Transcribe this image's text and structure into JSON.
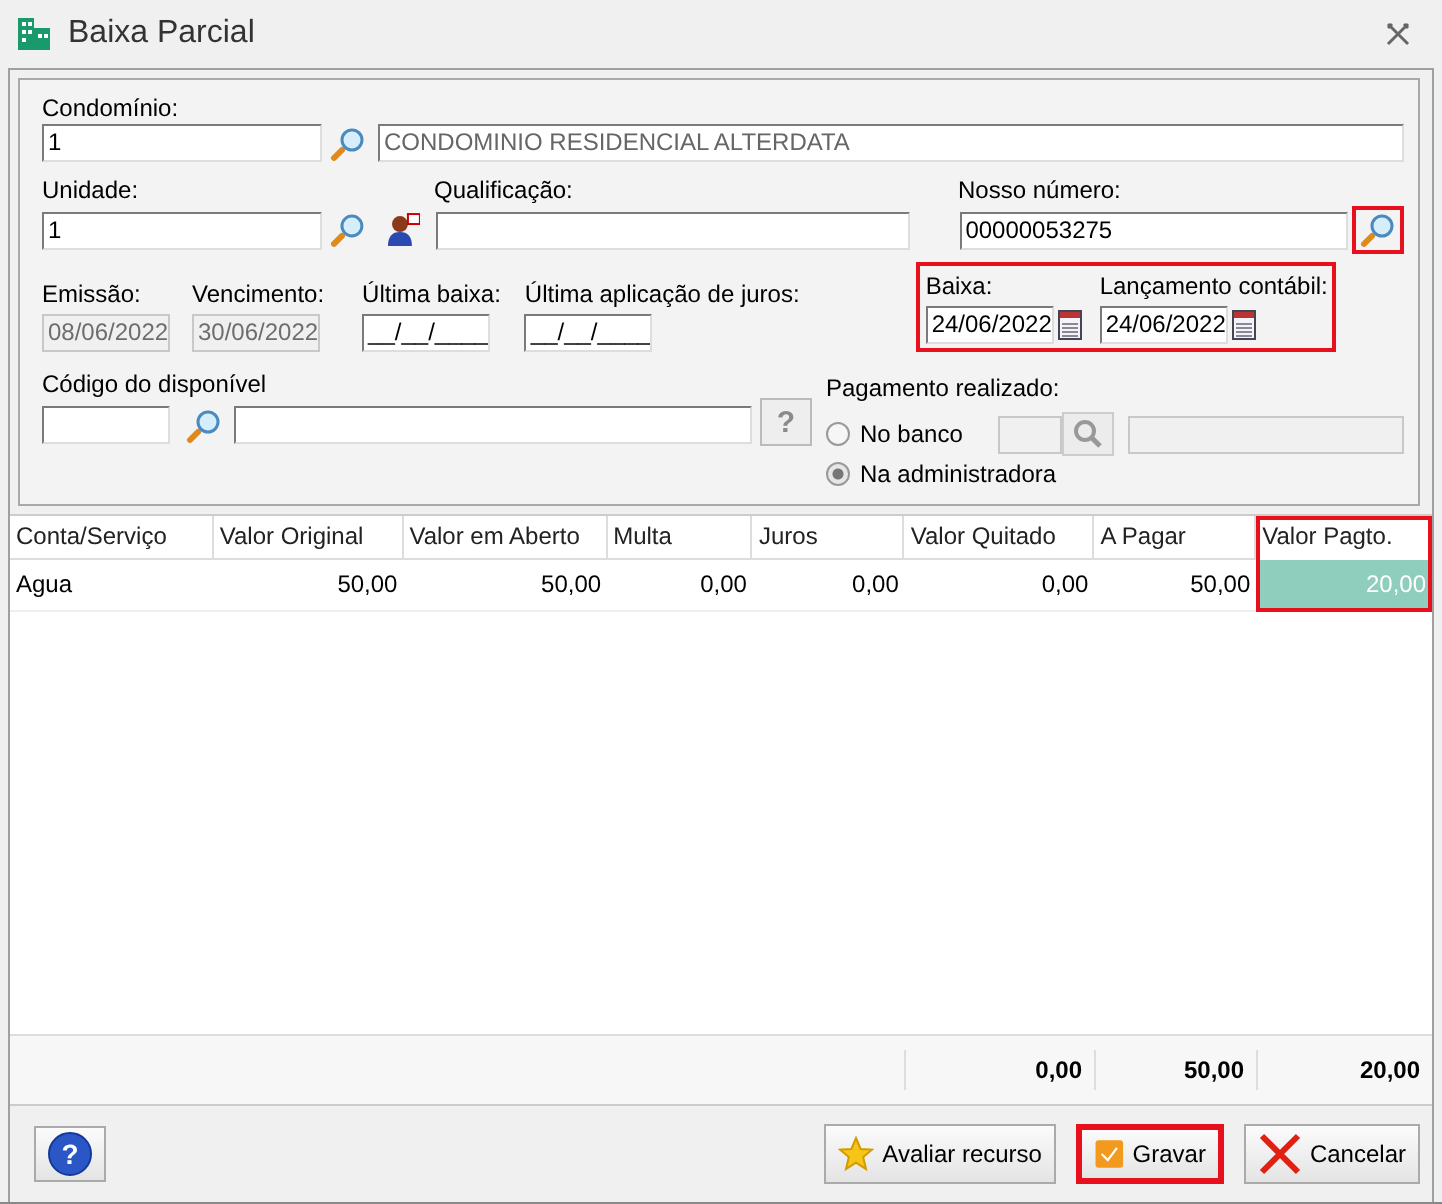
{
  "window": {
    "title": "Baixa Parcial"
  },
  "form": {
    "condominio": {
      "label": "Condomínio:",
      "code": "1",
      "name": "CONDOMINIO RESIDENCIAL ALTERDATA"
    },
    "unidade": {
      "label": "Unidade:",
      "value": "1"
    },
    "qualificacao": {
      "label": "Qualificação:"
    },
    "nosso_numero": {
      "label": "Nosso número:",
      "value": "00000053275",
      "search_highlighted": true
    },
    "dates": [
      {
        "label": "Emissão:",
        "value": "08/06/2022",
        "disabled": true
      },
      {
        "label": "Vencimento:",
        "value": "30/06/2022",
        "disabled": true
      },
      {
        "label": "Última baixa:",
        "value": "__/__/____",
        "disabled": false
      },
      {
        "label": "Última aplicação de juros:",
        "value": "__/__/____",
        "disabled": false
      }
    ],
    "posting_dates": {
      "highlighted": true,
      "items": [
        {
          "label": "Baixa:",
          "value": "24/06/2022"
        },
        {
          "label": "Lançamento contábil:",
          "value": "24/06/2022"
        }
      ]
    },
    "codigo": {
      "label": "Código do disponível",
      "help": "?"
    },
    "pagamento": {
      "label": "Pagamento realizado:",
      "options": [
        {
          "label": "No banco",
          "selected": false
        },
        {
          "label": "Na administradora",
          "selected": true
        }
      ]
    }
  },
  "table": {
    "columns": [
      {
        "label": "Conta/Serviço",
        "highlighted": false
      },
      {
        "label": "Valor Original",
        "highlighted": false
      },
      {
        "label": "Valor em Aberto",
        "highlighted": false
      },
      {
        "label": "Multa",
        "highlighted": false
      },
      {
        "label": "Juros",
        "highlighted": false
      },
      {
        "label": "Valor Quitado",
        "highlighted": false
      },
      {
        "label": "A Pagar",
        "highlighted": false
      },
      {
        "label": "Valor Pagto.",
        "highlighted": true
      }
    ],
    "rows": [
      {
        "cells": [
          {
            "text": "Agua",
            "selected": false
          },
          {
            "text": "50,00",
            "selected": false
          },
          {
            "text": "50,00",
            "selected": false
          },
          {
            "text": "0,00",
            "selected": false
          },
          {
            "text": "0,00",
            "selected": false
          },
          {
            "text": "0,00",
            "selected": false
          },
          {
            "text": "50,00",
            "selected": false
          },
          {
            "text": "20,00",
            "selected": true
          }
        ]
      }
    ],
    "totals": [
      "0,00",
      "50,00",
      "20,00"
    ]
  },
  "buttons": [
    {
      "kind": "help",
      "label": "?",
      "highlighted": false
    },
    {
      "kind": "rate",
      "label": "Avaliar recurso",
      "highlighted": false
    },
    {
      "kind": "save",
      "label": "Gravar",
      "highlighted": true
    },
    {
      "kind": "cancel",
      "label": "Cancelar",
      "highlighted": false
    }
  ]
}
